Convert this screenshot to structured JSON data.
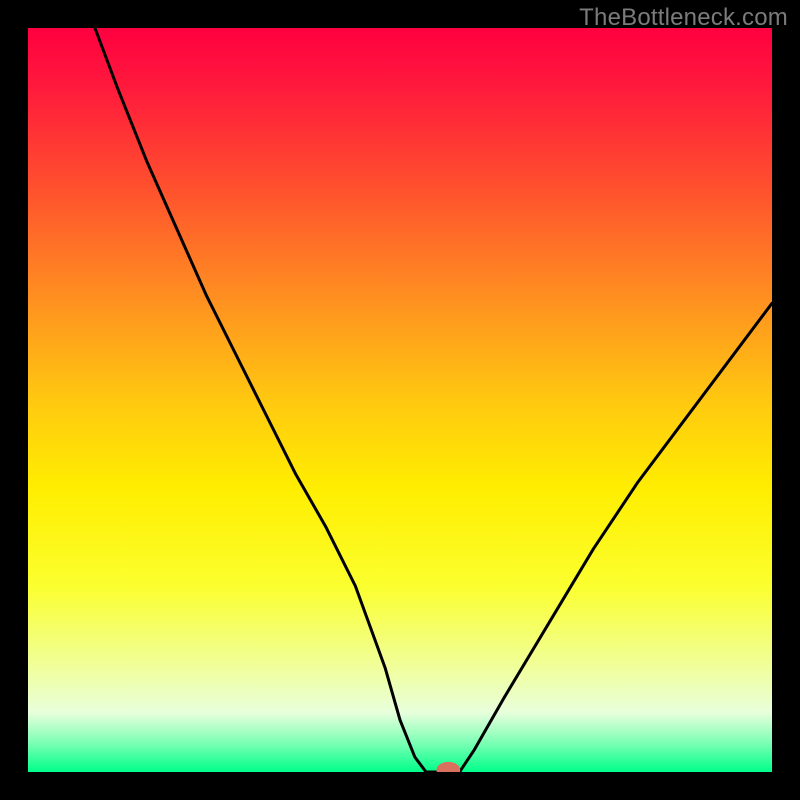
{
  "watermark": "TheBottleneck.com",
  "chart_data": {
    "type": "line",
    "title": "",
    "xlabel": "",
    "ylabel": "",
    "xlim": [
      0,
      100
    ],
    "ylim": [
      0,
      100
    ],
    "background_gradient": [
      {
        "pos": 0.0,
        "color": "#ff0040"
      },
      {
        "pos": 0.08,
        "color": "#ff1a3c"
      },
      {
        "pos": 0.2,
        "color": "#ff4a2f"
      },
      {
        "pos": 0.35,
        "color": "#ff8a22"
      },
      {
        "pos": 0.5,
        "color": "#ffc810"
      },
      {
        "pos": 0.62,
        "color": "#ffee00"
      },
      {
        "pos": 0.75,
        "color": "#fbff2e"
      },
      {
        "pos": 0.86,
        "color": "#f0ff9c"
      },
      {
        "pos": 0.92,
        "color": "#e8ffdc"
      },
      {
        "pos": 0.96,
        "color": "#7effb5"
      },
      {
        "pos": 1.0,
        "color": "#00ff8a"
      }
    ],
    "series": [
      {
        "name": "bottleneck-curve",
        "color": "#000000",
        "x": [
          9,
          12,
          16,
          20,
          24,
          28,
          32,
          36,
          40,
          44,
          48,
          50,
          52,
          53.5,
          55,
          58,
          60,
          64,
          70,
          76,
          82,
          88,
          94,
          100
        ],
        "y": [
          100,
          92,
          82,
          73,
          64,
          56,
          48,
          40,
          33,
          25,
          14,
          7,
          2,
          0,
          0,
          0,
          3,
          10,
          20,
          30,
          39,
          47,
          55,
          63
        ]
      }
    ],
    "marker": {
      "name": "optimal-point",
      "color": "#d96f5d",
      "x": 56.5,
      "y": 0,
      "rx": 1.6,
      "ry": 1.1
    }
  }
}
